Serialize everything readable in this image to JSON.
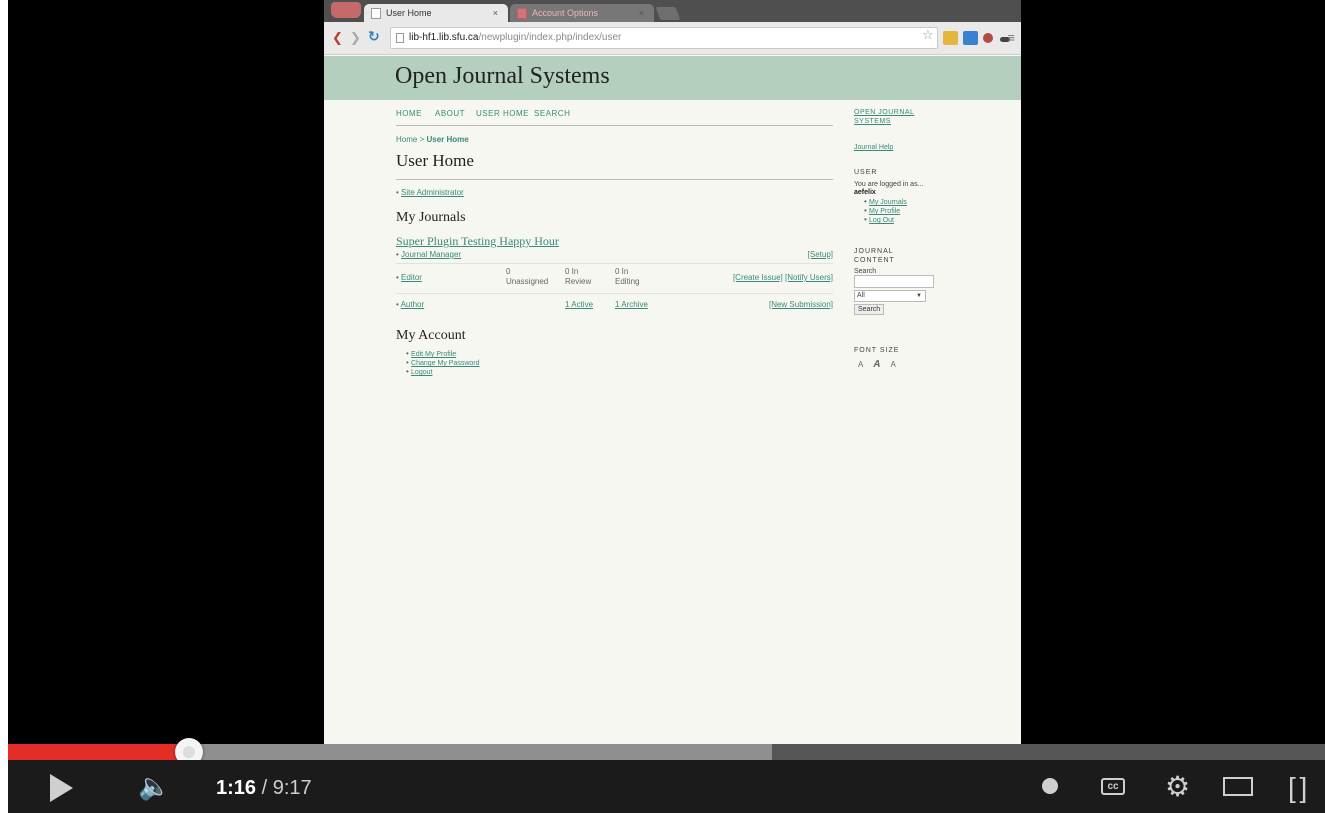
{
  "browser": {
    "tabs": [
      {
        "label": "User Home",
        "active": true
      },
      {
        "label": "Account Options",
        "active": false
      }
    ],
    "tab_close_glyph": "×",
    "url_host": "lib-hf1.lib.sfu.ca",
    "url_path": "/newplugin/index.php/index/user"
  },
  "page": {
    "site_title": "Open Journal Systems",
    "nav": [
      "HOME",
      "ABOUT",
      "USER HOME",
      "SEARCH"
    ],
    "breadcrumb_home": "Home",
    "breadcrumb_sep": " > ",
    "breadcrumb_current": "User Home",
    "title": "User Home",
    "site_admin_link": "Site Administrator",
    "my_journals_heading": "My Journals",
    "journal_name": "Super Plugin Testing Happy Hour",
    "roles": {
      "journal_manager": {
        "name": "Journal Manager",
        "action": "[Setup]"
      },
      "editor": {
        "name": "Editor",
        "stat1": "0",
        "stat1_label": "Unassigned",
        "stat2": "0 In",
        "stat2_label": "Review",
        "stat3": "0 In",
        "stat3_label": "Editing",
        "action1": "[Create Issue]",
        "action2": "[Notify Users]"
      },
      "author": {
        "name": "Author",
        "active": "1 Active",
        "archive": "1 Archive",
        "action": "[New Submission]"
      }
    },
    "my_account_heading": "My Account",
    "account_links": [
      "Edit My Profile",
      "Change My Password",
      "Logout"
    ]
  },
  "sidebar": {
    "ojs_link": "OPEN JOURNAL SYSTEMS",
    "help_link": "Journal Help",
    "user_heading": "USER",
    "logged_in_text": "You are logged in as...",
    "username": "aefelix",
    "user_links": [
      "My Journals",
      "My Profile",
      "Log Out"
    ],
    "content_heading": "JOURNAL CONTENT",
    "search_label": "Search",
    "search_scope": "All",
    "search_button": "Search",
    "font_size_heading": "FONT SIZE",
    "font_buttons": [
      "A",
      "A",
      "A"
    ]
  },
  "player": {
    "current_time": "1:16",
    "duration": "9:17",
    "played_fraction": 0.1377,
    "buffered_fraction": 0.58
  }
}
